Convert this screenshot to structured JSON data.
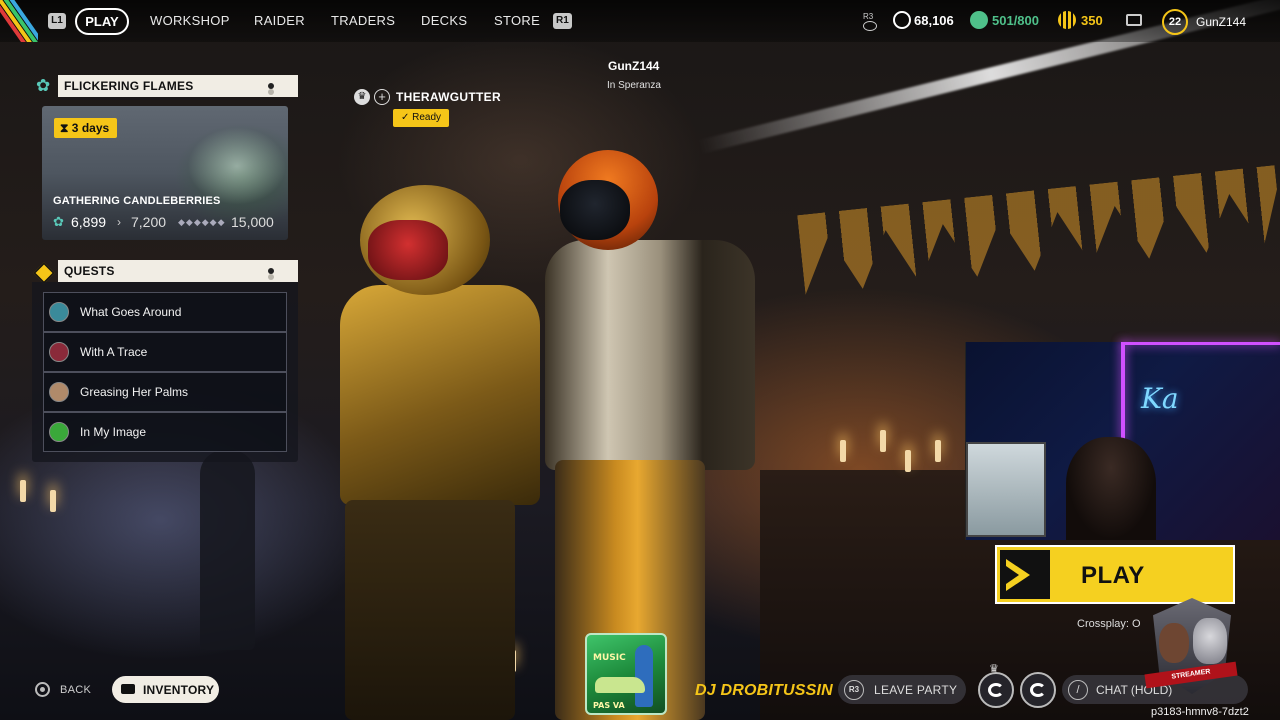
{
  "nav": {
    "left_bumper": "L1",
    "right_bumper": "R1",
    "tabs": [
      {
        "label": "PLAY",
        "active": true
      },
      {
        "label": "WORKSHOP"
      },
      {
        "label": "RAIDER"
      },
      {
        "label": "TRADERS"
      },
      {
        "label": "DECKS"
      },
      {
        "label": "STORE"
      }
    ]
  },
  "stats": {
    "r3_key": "R3",
    "credits": "68,106",
    "inventory": "501/800",
    "tokens": "350",
    "level": "22",
    "username": "GunZ144",
    "colors": {
      "credits": "#ffffff",
      "inventory": "#4fc08a",
      "tokens": "#f5c518"
    }
  },
  "event": {
    "title": "FLICKERING FLAMES",
    "timer_value": "3",
    "timer_unit": "days",
    "name": "GATHERING CANDLEBERRIES",
    "current": "6,899",
    "next": "7,200",
    "max": "15,000",
    "pips": "◆◆◆◆◆◆"
  },
  "quests": {
    "title": "QUESTS",
    "items": [
      {
        "label": "What Goes Around",
        "color": "#3a8a9a"
      },
      {
        "label": "With A Trace",
        "color": "#8a2a3a"
      },
      {
        "label": "Greasing Her Palms",
        "color": "#b08a6a"
      },
      {
        "label": "In My Image",
        "color": "#3aa83a"
      }
    ]
  },
  "party": {
    "member_name": "THERAWGUTTER",
    "ready_label": "✓  Ready",
    "player_name": "GunZ144",
    "player_location": "In Speranza"
  },
  "play": {
    "label": "PLAY",
    "crossplay": "Crossplay: O"
  },
  "bottom": {
    "back": "BACK",
    "inventory": "INVENTORY",
    "dj": "DJ DROBITUSSIN",
    "leave_key": "R3",
    "leave": "LEAVE PARTY",
    "chat": "CHAT (HOLD)",
    "session": "p3183-hmnv8-7dzt2",
    "album_line1": "MUSIC",
    "album_line2": "PAS VA"
  },
  "overlay": {
    "sign": "Ka",
    "streamer_banner": "STREAMER"
  }
}
